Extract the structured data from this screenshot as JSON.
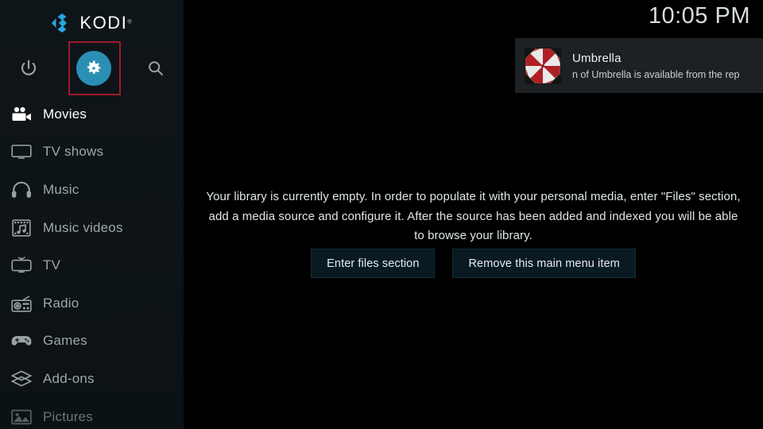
{
  "app": {
    "name": "KODI",
    "trademark": "®",
    "logo_icon": "kodi-logo-icon",
    "accent_color": "#2b8fb5",
    "highlight_color": "#9c1b2b"
  },
  "header": {
    "clock": "10:05 PM"
  },
  "sidebar": {
    "top_buttons": [
      {
        "name": "power",
        "icon": "power-icon",
        "label": "Power"
      },
      {
        "name": "settings",
        "icon": "gear-icon",
        "label": "Settings",
        "highlighted": true
      },
      {
        "name": "search",
        "icon": "search-icon",
        "label": "Search"
      }
    ],
    "items": [
      {
        "label": "Movies",
        "icon": "movie-camera-icon",
        "selected": true
      },
      {
        "label": "TV shows",
        "icon": "television-icon",
        "selected": false
      },
      {
        "label": "Music",
        "icon": "headphones-icon",
        "selected": false
      },
      {
        "label": "Music videos",
        "icon": "music-film-icon",
        "selected": false
      },
      {
        "label": "TV",
        "icon": "tv-antenna-icon",
        "selected": false
      },
      {
        "label": "Radio",
        "icon": "radio-icon",
        "selected": false
      },
      {
        "label": "Games",
        "icon": "gamepad-icon",
        "selected": false
      },
      {
        "label": "Add-ons",
        "icon": "addons-box-icon",
        "selected": false
      },
      {
        "label": "Pictures",
        "icon": "pictures-icon",
        "selected": false,
        "dimmed": true
      }
    ]
  },
  "notification": {
    "icon": "umbrella-corp-icon",
    "title": "Umbrella",
    "message": "n of Umbrella is available from the rep"
  },
  "main": {
    "empty_message": "Your library is currently empty. In order to populate it with your personal media, enter \"Files\" section, add a media source and configure it. After the source has been added and indexed you will be able to browse your library.",
    "buttons": [
      {
        "label": "Enter files section"
      },
      {
        "label": "Remove this main menu item"
      }
    ]
  }
}
